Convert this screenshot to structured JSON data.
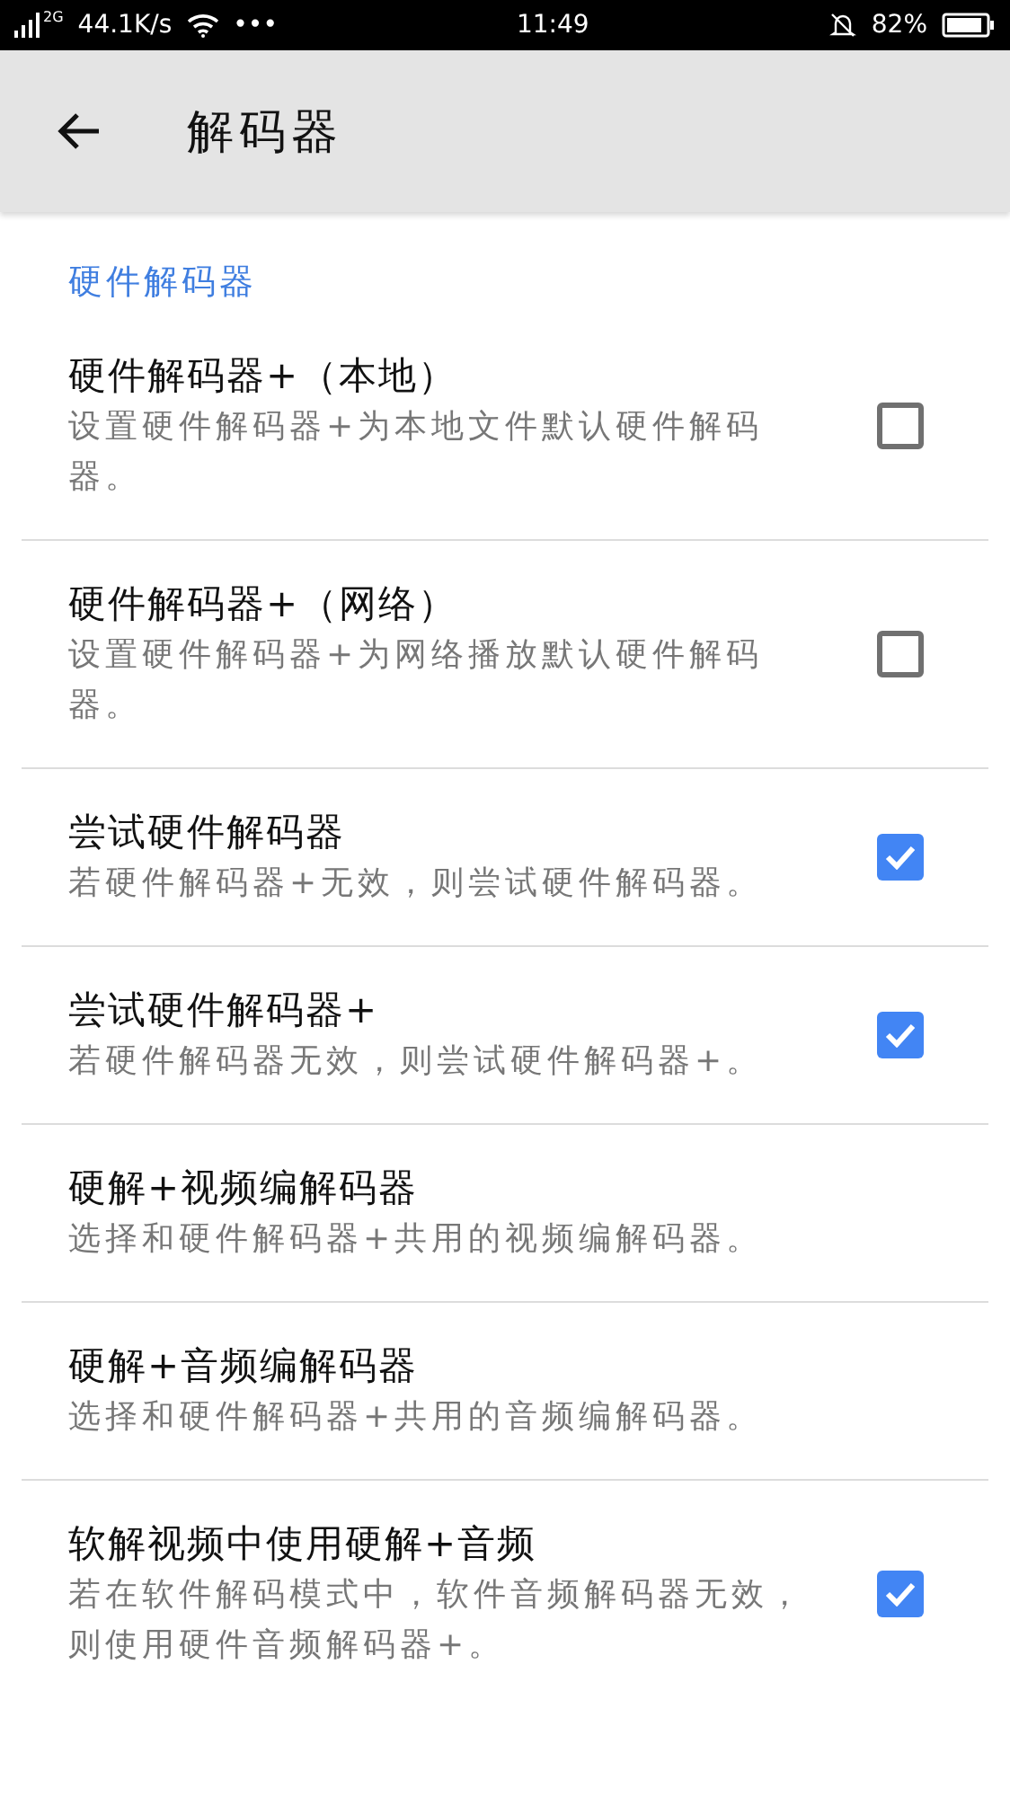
{
  "status_bar": {
    "network_type": "2G",
    "speed": "44.1K/s",
    "more": "•••",
    "time": "11:49",
    "battery": "82%"
  },
  "app_bar": {
    "title": "解码器"
  },
  "section": {
    "title": "硬件解码器"
  },
  "settings": [
    {
      "kind": "checkbox",
      "title": "硬件解码器+（本地）",
      "summary": "设置硬件解码器+为本地文件默认硬件解码器。",
      "checked": false
    },
    {
      "kind": "checkbox",
      "title": "硬件解码器+（网络）",
      "summary": "设置硬件解码器+为网络播放默认硬件解码器。",
      "checked": false
    },
    {
      "kind": "checkbox",
      "title": "尝试硬件解码器",
      "summary": "若硬件解码器+无效，则尝试硬件解码器。",
      "checked": true
    },
    {
      "kind": "checkbox",
      "title": "尝试硬件解码器+",
      "summary": "若硬件解码器无效，则尝试硬件解码器+。",
      "checked": true
    },
    {
      "kind": "plain",
      "title": "硬解+视频编解码器",
      "summary": "选择和硬件解码器+共用的视频编解码器。"
    },
    {
      "kind": "plain",
      "title": "硬解+音频编解码器",
      "summary": "选择和硬件解码器+共用的音频编解码器。"
    },
    {
      "kind": "checkbox",
      "title": "软解视频中使用硬解+音频",
      "summary": "若在软件解码模式中，软件音频解码器无效，则使用硬件音频解码器+。",
      "checked": true
    }
  ]
}
